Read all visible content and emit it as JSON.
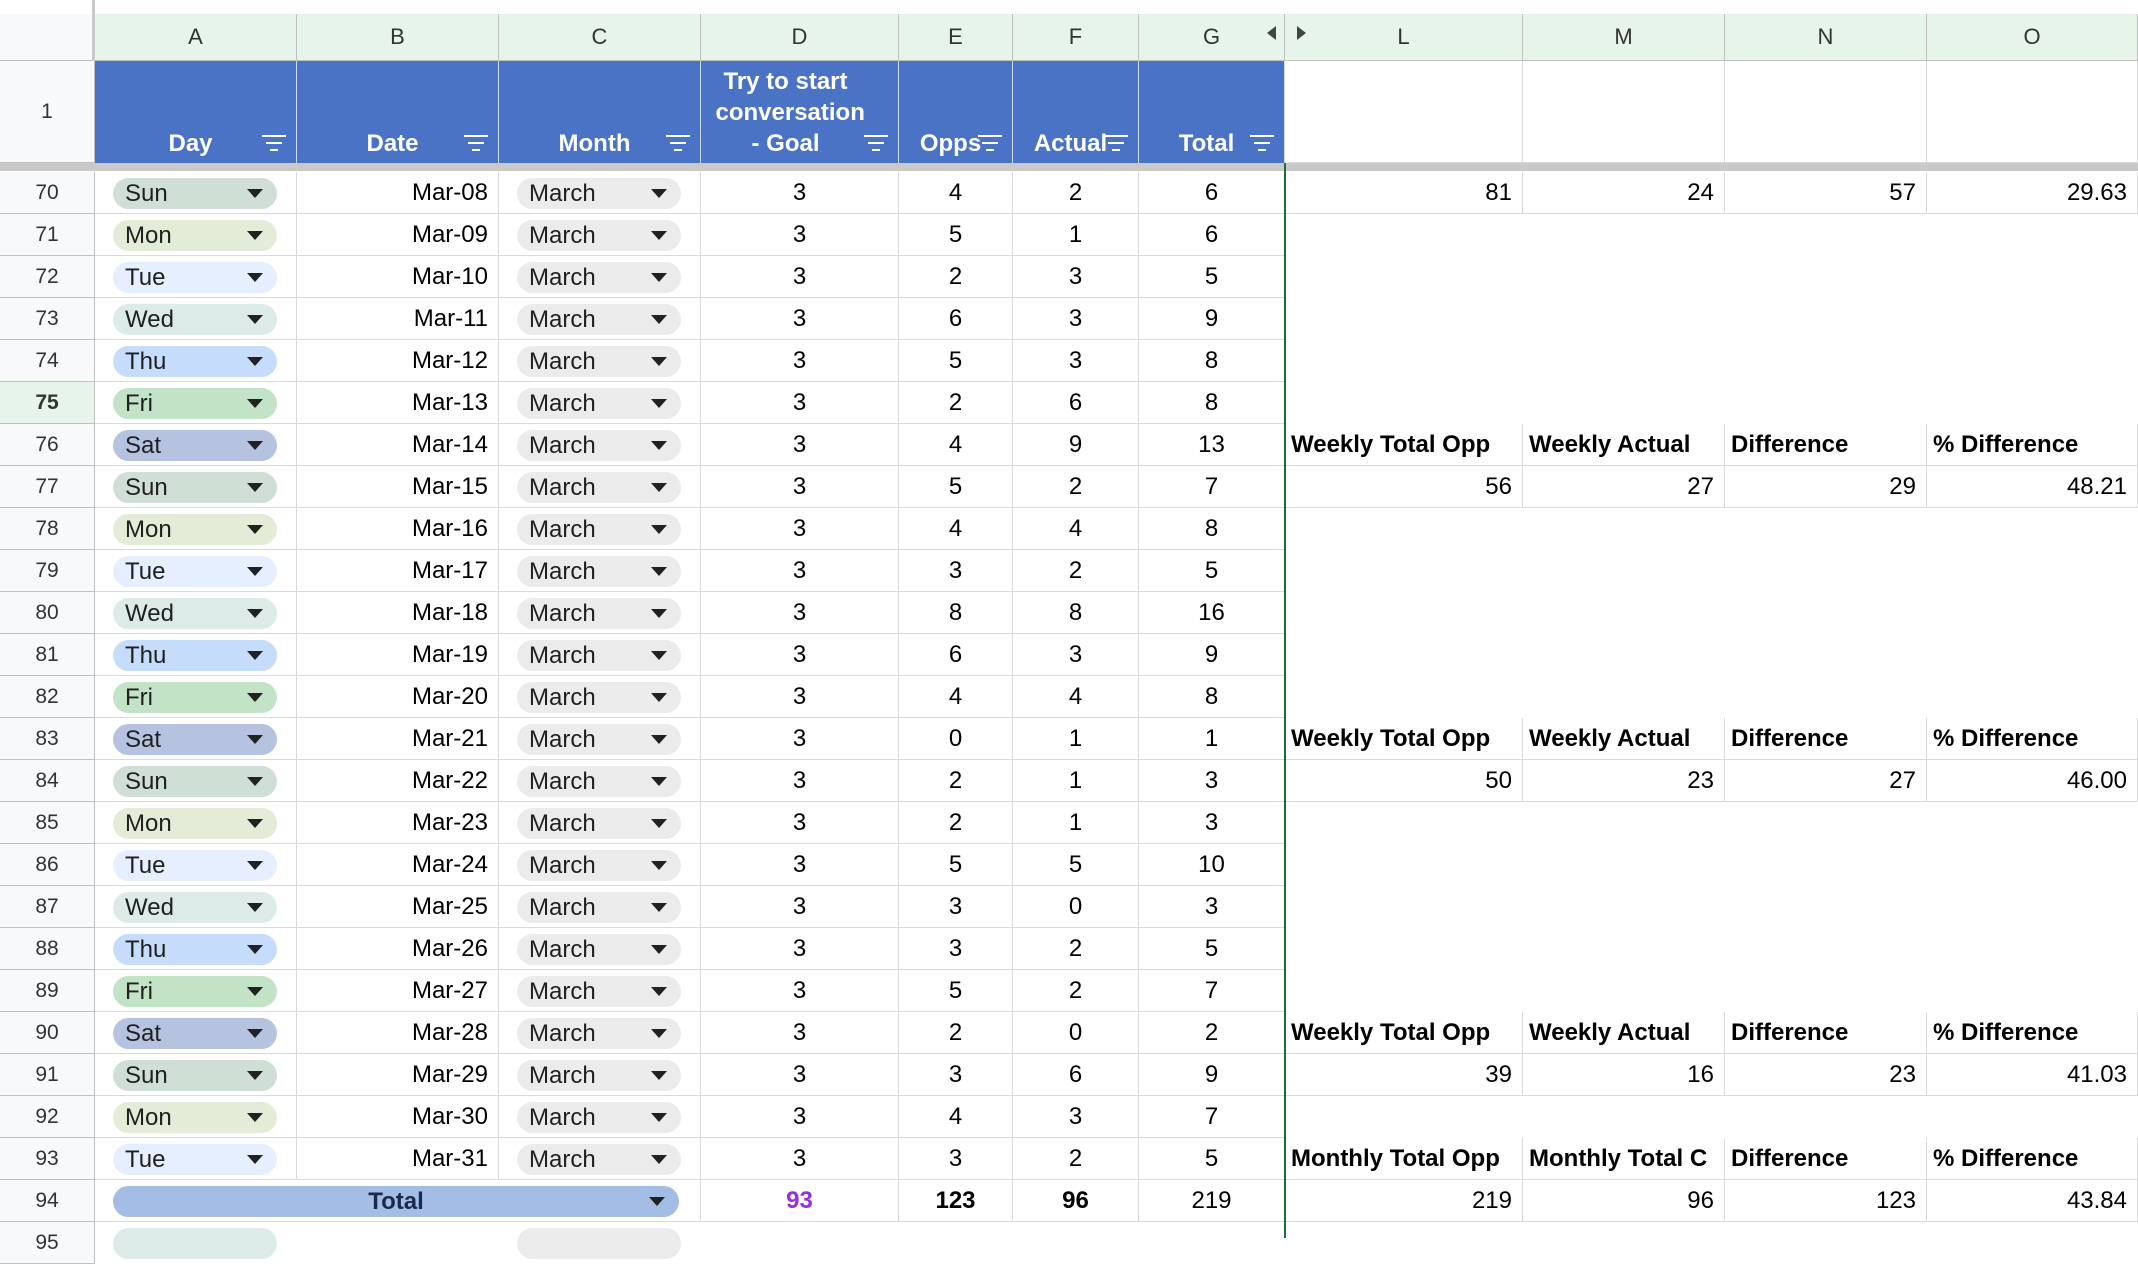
{
  "columns": {
    "a": "A",
    "b": "B",
    "c": "C",
    "d": "D",
    "e": "E",
    "f": "F",
    "g": "G",
    "l": "L",
    "m": "M",
    "n": "N",
    "o": "O"
  },
  "header_row_number": "1",
  "headers": {
    "day": "Day",
    "date": "Date",
    "month": "Month",
    "goal": "Try to start conversation - Goal",
    "opps": "Opps",
    "actual": "Actual",
    "total": "Total"
  },
  "rows": [
    {
      "n": "70",
      "day": "Sun",
      "date": "Mar-08",
      "month": "March",
      "goal": "3",
      "opps": "4",
      "actual": "2",
      "total": "6"
    },
    {
      "n": "71",
      "day": "Mon",
      "date": "Mar-09",
      "month": "March",
      "goal": "3",
      "opps": "5",
      "actual": "1",
      "total": "6"
    },
    {
      "n": "72",
      "day": "Tue",
      "date": "Mar-10",
      "month": "March",
      "goal": "3",
      "opps": "2",
      "actual": "3",
      "total": "5"
    },
    {
      "n": "73",
      "day": "Wed",
      "date": "Mar-11",
      "month": "March",
      "goal": "3",
      "opps": "6",
      "actual": "3",
      "total": "9"
    },
    {
      "n": "74",
      "day": "Thu",
      "date": "Mar-12",
      "month": "March",
      "goal": "3",
      "opps": "5",
      "actual": "3",
      "total": "8"
    },
    {
      "n": "75",
      "day": "Fri",
      "date": "Mar-13",
      "month": "March",
      "goal": "3",
      "opps": "2",
      "actual": "6",
      "total": "8"
    },
    {
      "n": "76",
      "day": "Sat",
      "date": "Mar-14",
      "month": "March",
      "goal": "3",
      "opps": "4",
      "actual": "9",
      "total": "13"
    },
    {
      "n": "77",
      "day": "Sun",
      "date": "Mar-15",
      "month": "March",
      "goal": "3",
      "opps": "5",
      "actual": "2",
      "total": "7"
    },
    {
      "n": "78",
      "day": "Mon",
      "date": "Mar-16",
      "month": "March",
      "goal": "3",
      "opps": "4",
      "actual": "4",
      "total": "8"
    },
    {
      "n": "79",
      "day": "Tue",
      "date": "Mar-17",
      "month": "March",
      "goal": "3",
      "opps": "3",
      "actual": "2",
      "total": "5"
    },
    {
      "n": "80",
      "day": "Wed",
      "date": "Mar-18",
      "month": "March",
      "goal": "3",
      "opps": "8",
      "actual": "8",
      "total": "16"
    },
    {
      "n": "81",
      "day": "Thu",
      "date": "Mar-19",
      "month": "March",
      "goal": "3",
      "opps": "6",
      "actual": "3",
      "total": "9"
    },
    {
      "n": "82",
      "day": "Fri",
      "date": "Mar-20",
      "month": "March",
      "goal": "3",
      "opps": "4",
      "actual": "4",
      "total": "8"
    },
    {
      "n": "83",
      "day": "Sat",
      "date": "Mar-21",
      "month": "March",
      "goal": "3",
      "opps": "0",
      "actual": "1",
      "total": "1"
    },
    {
      "n": "84",
      "day": "Sun",
      "date": "Mar-22",
      "month": "March",
      "goal": "3",
      "opps": "2",
      "actual": "1",
      "total": "3"
    },
    {
      "n": "85",
      "day": "Mon",
      "date": "Mar-23",
      "month": "March",
      "goal": "3",
      "opps": "2",
      "actual": "1",
      "total": "3"
    },
    {
      "n": "86",
      "day": "Tue",
      "date": "Mar-24",
      "month": "March",
      "goal": "3",
      "opps": "5",
      "actual": "5",
      "total": "10"
    },
    {
      "n": "87",
      "day": "Wed",
      "date": "Mar-25",
      "month": "March",
      "goal": "3",
      "opps": "3",
      "actual": "0",
      "total": "3"
    },
    {
      "n": "88",
      "day": "Thu",
      "date": "Mar-26",
      "month": "March",
      "goal": "3",
      "opps": "3",
      "actual": "2",
      "total": "5"
    },
    {
      "n": "89",
      "day": "Fri",
      "date": "Mar-27",
      "month": "March",
      "goal": "3",
      "opps": "5",
      "actual": "2",
      "total": "7"
    },
    {
      "n": "90",
      "day": "Sat",
      "date": "Mar-28",
      "month": "March",
      "goal": "3",
      "opps": "2",
      "actual": "0",
      "total": "2"
    },
    {
      "n": "91",
      "day": "Sun",
      "date": "Mar-29",
      "month": "March",
      "goal": "3",
      "opps": "3",
      "actual": "6",
      "total": "9"
    },
    {
      "n": "92",
      "day": "Mon",
      "date": "Mar-30",
      "month": "March",
      "goal": "3",
      "opps": "4",
      "actual": "3",
      "total": "7"
    },
    {
      "n": "93",
      "day": "Tue",
      "date": "Mar-31",
      "month": "March",
      "goal": "3",
      "opps": "3",
      "actual": "2",
      "total": "5"
    }
  ],
  "total_row": {
    "n": "94",
    "label": "Total",
    "goal": "93",
    "opps": "123",
    "actual": "96",
    "total": "219"
  },
  "partial_row_number": "95",
  "summary": {
    "r70": {
      "l": "81",
      "m": "24",
      "n": "57",
      "o": "29.63"
    },
    "r76_labels": {
      "l": "Weekly Total Opp",
      "m": "Weekly Actual",
      "n": "Difference",
      "o": "% Difference"
    },
    "r77": {
      "l": "56",
      "m": "27",
      "n": "29",
      "o": "48.21"
    },
    "r83_labels": {
      "l": "Weekly Total Opp",
      "m": "Weekly Actual",
      "n": "Difference",
      "o": "% Difference"
    },
    "r84": {
      "l": "50",
      "m": "23",
      "n": "27",
      "o": "46.00"
    },
    "r90_labels": {
      "l": "Weekly Total Opp",
      "m": "Weekly Actual",
      "n": "Difference",
      "o": "% Difference"
    },
    "r91": {
      "l": "39",
      "m": "16",
      "n": "23",
      "o": "41.03"
    },
    "r93_labels": {
      "l": "Monthly Total Opp",
      "m": "Monthly Total C",
      "n": "Difference",
      "o": "% Difference"
    },
    "r94": {
      "l": "219",
      "m": "96",
      "n": "123",
      "o": "43.84"
    }
  },
  "colors": {
    "header_blue": "#4a73c6",
    "total_chip": "#a4bde5",
    "goal_total_purple": "#9b2cd8",
    "day_chips": {
      "Sun": "#d0dfd6",
      "Mon": "#e2ecd6",
      "Tue": "#e6efff",
      "Wed": "#dcebe8",
      "Thu": "#c6dcfb",
      "Fri": "#c3e3c6",
      "Sat": "#b5c2e0"
    }
  }
}
